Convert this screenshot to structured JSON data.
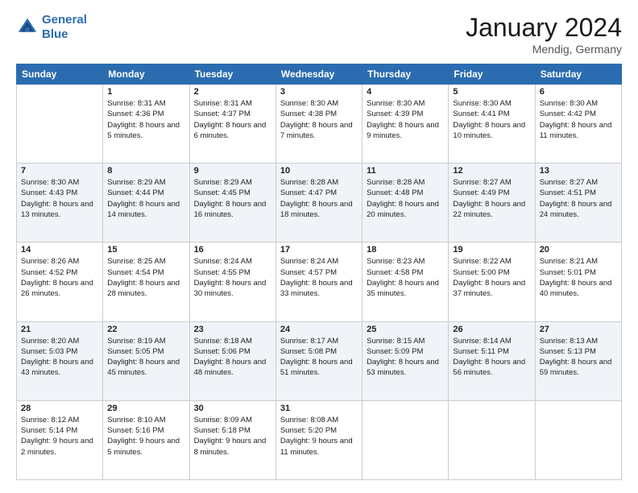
{
  "header": {
    "logo_line1": "General",
    "logo_line2": "Blue",
    "month": "January 2024",
    "location": "Mendig, Germany"
  },
  "weekdays": [
    "Sunday",
    "Monday",
    "Tuesday",
    "Wednesday",
    "Thursday",
    "Friday",
    "Saturday"
  ],
  "weeks": [
    [
      {
        "day": "",
        "sunrise": "",
        "sunset": "",
        "daylight": ""
      },
      {
        "day": "1",
        "sunrise": "Sunrise: 8:31 AM",
        "sunset": "Sunset: 4:36 PM",
        "daylight": "Daylight: 8 hours and 5 minutes."
      },
      {
        "day": "2",
        "sunrise": "Sunrise: 8:31 AM",
        "sunset": "Sunset: 4:37 PM",
        "daylight": "Daylight: 8 hours and 6 minutes."
      },
      {
        "day": "3",
        "sunrise": "Sunrise: 8:30 AM",
        "sunset": "Sunset: 4:38 PM",
        "daylight": "Daylight: 8 hours and 7 minutes."
      },
      {
        "day": "4",
        "sunrise": "Sunrise: 8:30 AM",
        "sunset": "Sunset: 4:39 PM",
        "daylight": "Daylight: 8 hours and 9 minutes."
      },
      {
        "day": "5",
        "sunrise": "Sunrise: 8:30 AM",
        "sunset": "Sunset: 4:41 PM",
        "daylight": "Daylight: 8 hours and 10 minutes."
      },
      {
        "day": "6",
        "sunrise": "Sunrise: 8:30 AM",
        "sunset": "Sunset: 4:42 PM",
        "daylight": "Daylight: 8 hours and 11 minutes."
      }
    ],
    [
      {
        "day": "7",
        "sunrise": "Sunrise: 8:30 AM",
        "sunset": "Sunset: 4:43 PM",
        "daylight": "Daylight: 8 hours and 13 minutes."
      },
      {
        "day": "8",
        "sunrise": "Sunrise: 8:29 AM",
        "sunset": "Sunset: 4:44 PM",
        "daylight": "Daylight: 8 hours and 14 minutes."
      },
      {
        "day": "9",
        "sunrise": "Sunrise: 8:29 AM",
        "sunset": "Sunset: 4:45 PM",
        "daylight": "Daylight: 8 hours and 16 minutes."
      },
      {
        "day": "10",
        "sunrise": "Sunrise: 8:28 AM",
        "sunset": "Sunset: 4:47 PM",
        "daylight": "Daylight: 8 hours and 18 minutes."
      },
      {
        "day": "11",
        "sunrise": "Sunrise: 8:28 AM",
        "sunset": "Sunset: 4:48 PM",
        "daylight": "Daylight: 8 hours and 20 minutes."
      },
      {
        "day": "12",
        "sunrise": "Sunrise: 8:27 AM",
        "sunset": "Sunset: 4:49 PM",
        "daylight": "Daylight: 8 hours and 22 minutes."
      },
      {
        "day": "13",
        "sunrise": "Sunrise: 8:27 AM",
        "sunset": "Sunset: 4:51 PM",
        "daylight": "Daylight: 8 hours and 24 minutes."
      }
    ],
    [
      {
        "day": "14",
        "sunrise": "Sunrise: 8:26 AM",
        "sunset": "Sunset: 4:52 PM",
        "daylight": "Daylight: 8 hours and 26 minutes."
      },
      {
        "day": "15",
        "sunrise": "Sunrise: 8:25 AM",
        "sunset": "Sunset: 4:54 PM",
        "daylight": "Daylight: 8 hours and 28 minutes."
      },
      {
        "day": "16",
        "sunrise": "Sunrise: 8:24 AM",
        "sunset": "Sunset: 4:55 PM",
        "daylight": "Daylight: 8 hours and 30 minutes."
      },
      {
        "day": "17",
        "sunrise": "Sunrise: 8:24 AM",
        "sunset": "Sunset: 4:57 PM",
        "daylight": "Daylight: 8 hours and 33 minutes."
      },
      {
        "day": "18",
        "sunrise": "Sunrise: 8:23 AM",
        "sunset": "Sunset: 4:58 PM",
        "daylight": "Daylight: 8 hours and 35 minutes."
      },
      {
        "day": "19",
        "sunrise": "Sunrise: 8:22 AM",
        "sunset": "Sunset: 5:00 PM",
        "daylight": "Daylight: 8 hours and 37 minutes."
      },
      {
        "day": "20",
        "sunrise": "Sunrise: 8:21 AM",
        "sunset": "Sunset: 5:01 PM",
        "daylight": "Daylight: 8 hours and 40 minutes."
      }
    ],
    [
      {
        "day": "21",
        "sunrise": "Sunrise: 8:20 AM",
        "sunset": "Sunset: 5:03 PM",
        "daylight": "Daylight: 8 hours and 43 minutes."
      },
      {
        "day": "22",
        "sunrise": "Sunrise: 8:19 AM",
        "sunset": "Sunset: 5:05 PM",
        "daylight": "Daylight: 8 hours and 45 minutes."
      },
      {
        "day": "23",
        "sunrise": "Sunrise: 8:18 AM",
        "sunset": "Sunset: 5:06 PM",
        "daylight": "Daylight: 8 hours and 48 minutes."
      },
      {
        "day": "24",
        "sunrise": "Sunrise: 8:17 AM",
        "sunset": "Sunset: 5:08 PM",
        "daylight": "Daylight: 8 hours and 51 minutes."
      },
      {
        "day": "25",
        "sunrise": "Sunrise: 8:15 AM",
        "sunset": "Sunset: 5:09 PM",
        "daylight": "Daylight: 8 hours and 53 minutes."
      },
      {
        "day": "26",
        "sunrise": "Sunrise: 8:14 AM",
        "sunset": "Sunset: 5:11 PM",
        "daylight": "Daylight: 8 hours and 56 minutes."
      },
      {
        "day": "27",
        "sunrise": "Sunrise: 8:13 AM",
        "sunset": "Sunset: 5:13 PM",
        "daylight": "Daylight: 8 hours and 59 minutes."
      }
    ],
    [
      {
        "day": "28",
        "sunrise": "Sunrise: 8:12 AM",
        "sunset": "Sunset: 5:14 PM",
        "daylight": "Daylight: 9 hours and 2 minutes."
      },
      {
        "day": "29",
        "sunrise": "Sunrise: 8:10 AM",
        "sunset": "Sunset: 5:16 PM",
        "daylight": "Daylight: 9 hours and 5 minutes."
      },
      {
        "day": "30",
        "sunrise": "Sunrise: 8:09 AM",
        "sunset": "Sunset: 5:18 PM",
        "daylight": "Daylight: 9 hours and 8 minutes."
      },
      {
        "day": "31",
        "sunrise": "Sunrise: 8:08 AM",
        "sunset": "Sunset: 5:20 PM",
        "daylight": "Daylight: 9 hours and 11 minutes."
      },
      {
        "day": "",
        "sunrise": "",
        "sunset": "",
        "daylight": ""
      },
      {
        "day": "",
        "sunrise": "",
        "sunset": "",
        "daylight": ""
      },
      {
        "day": "",
        "sunrise": "",
        "sunset": "",
        "daylight": ""
      }
    ]
  ]
}
